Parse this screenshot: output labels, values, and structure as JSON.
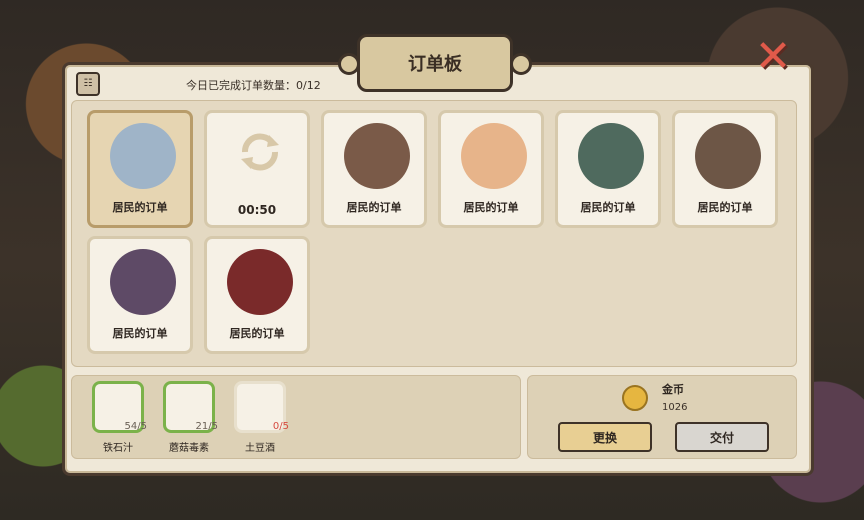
{
  "title": "订单板",
  "close_icon": "close-x",
  "menu_icon": "menu-list-icon",
  "counter_text": "今日已完成订单数量：0/12",
  "orders": [
    {
      "label": "居民的订单",
      "selected": true,
      "face_color": "#9fb4c8"
    },
    {
      "timer": "00:50",
      "refresh": true
    },
    {
      "label": "居民的订单",
      "face_color": "#7a5a48"
    },
    {
      "label": "居民的订单",
      "face_color": "#e7b48a"
    },
    {
      "label": "居民的订单",
      "face_color": "#4f6a5e"
    },
    {
      "label": "居民的订单",
      "face_color": "#6d5646"
    },
    {
      "label": "居民的订单",
      "face_color": "#5e4a66"
    },
    {
      "label": "居民的订单",
      "face_color": "#7a2a2a"
    }
  ],
  "items": [
    {
      "name": "铁石汁",
      "qty": "54/5",
      "low": false,
      "icon": "iron-juice-icon"
    },
    {
      "name": "蘑菇毒素",
      "qty": "21/5",
      "low": false,
      "icon": "mushroom-toxin-icon"
    },
    {
      "name": "土豆酒",
      "qty": "0/5",
      "low": true,
      "icon": "potato-wine-icon"
    }
  ],
  "coin": {
    "label": "金币",
    "value": "1026"
  },
  "buttons": {
    "replace": "更换",
    "deliver": "交付"
  }
}
